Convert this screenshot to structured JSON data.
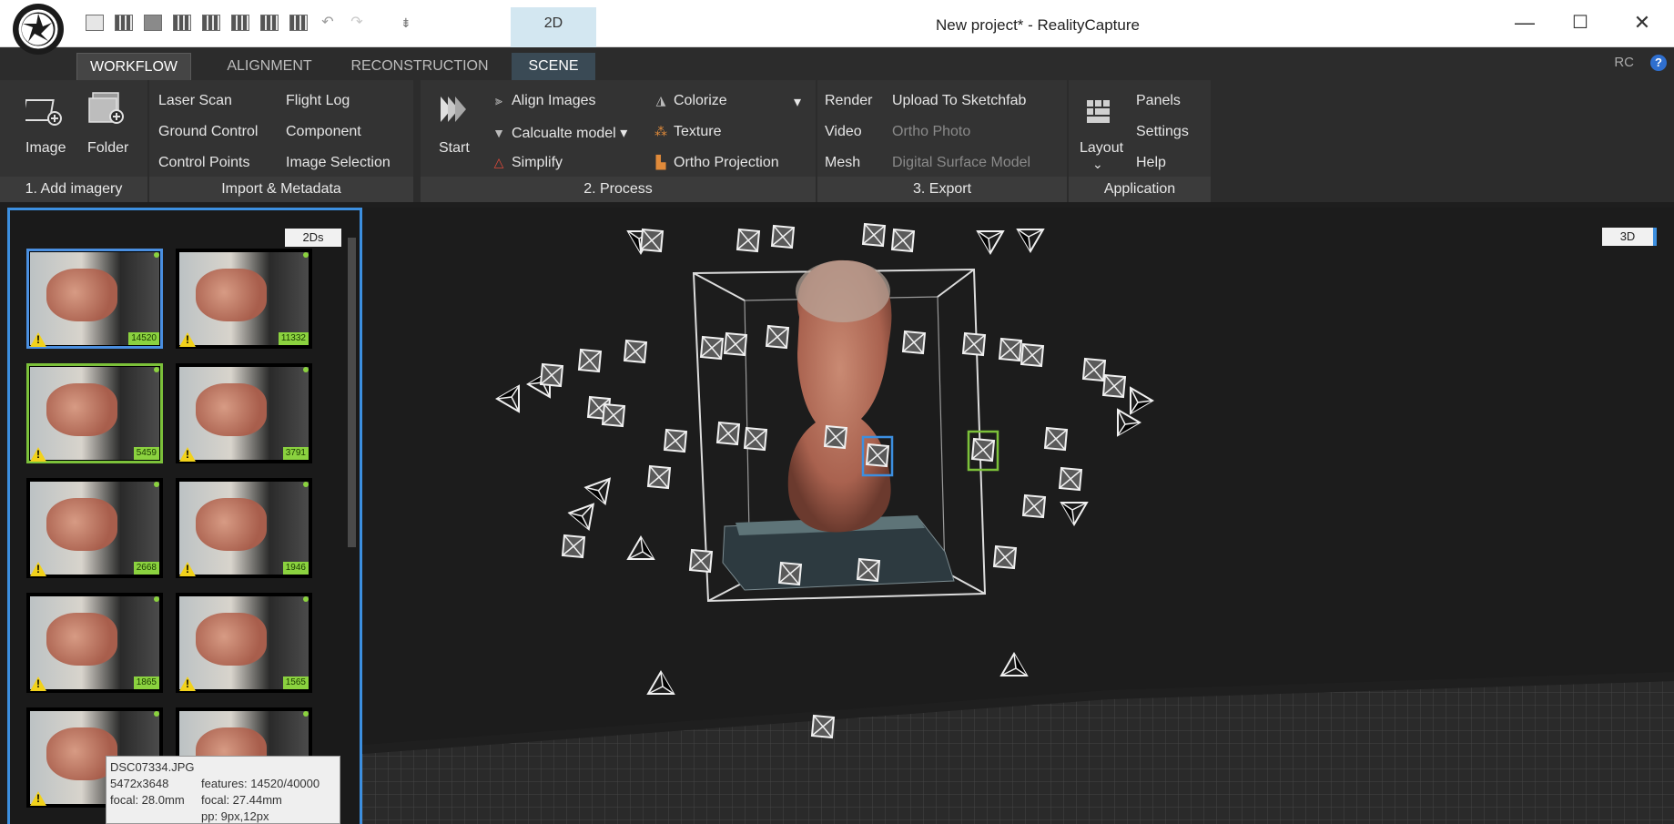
{
  "window": {
    "title": "New project* - RealityCapture",
    "minimize_glyph": "—",
    "maximize_glyph": "☐",
    "close_glyph": "✕"
  },
  "quick_access": {
    "icons": [
      "layout-1-icon",
      "layout-2-icon",
      "layout-3-icon",
      "layout-4-icon",
      "layout-5-icon",
      "layout-6-icon",
      "layout-7-icon",
      "layout-8-icon",
      "undo-icon",
      "redo-icon",
      "customize-icon"
    ],
    "undo_glyph": "↶",
    "redo_glyph": "↷",
    "customize_glyph": "⇟"
  },
  "view_tab_2d": "2D",
  "tabs": [
    {
      "label": "WORKFLOW",
      "active": true
    },
    {
      "label": "ALIGNMENT",
      "active": false
    },
    {
      "label": "RECONSTRUCTION",
      "active": false
    },
    {
      "label": "SCENE",
      "active": false
    }
  ],
  "rc_label": "RC",
  "help_glyph": "?",
  "ribbon": {
    "add_imagery": {
      "label": "1. Add imagery",
      "image": "Image",
      "folder": "Folder"
    },
    "import_metadata": {
      "label": "Import & Metadata",
      "col1": [
        "Laser Scan",
        "Ground Control",
        "Control Points"
      ],
      "col2": [
        "Flight Log",
        "Component",
        "Image Selection"
      ]
    },
    "process": {
      "label": "2. Process",
      "start": "Start",
      "align_images": "Align Images",
      "calculate_model": "Calcualte model",
      "simplify": "Simplify",
      "colorize": "Colorize",
      "texture": "Texture",
      "ortho_projection": "Ortho Projection",
      "dropdown_glyph": "▾"
    },
    "export": {
      "label": "3. Export",
      "col1": [
        "Render",
        "Video",
        "Mesh"
      ],
      "col2": [
        "Upload To Sketchfab",
        "Ortho Photo",
        "Digital Surface Model"
      ]
    },
    "application": {
      "label": "Application",
      "layout": "Layout",
      "layout_arrow": "⌄",
      "items": [
        "Panels",
        "Settings",
        "Help"
      ]
    }
  },
  "left_panel": {
    "tag": "2Ds",
    "thumbnails": [
      {
        "count": "14520",
        "state": "blue"
      },
      {
        "count": "11332",
        "state": "none"
      },
      {
        "count": "5459",
        "state": "green"
      },
      {
        "count": "3791",
        "state": "none"
      },
      {
        "count": "2668",
        "state": "none"
      },
      {
        "count": "1946",
        "state": "none"
      },
      {
        "count": "1865",
        "state": "none"
      },
      {
        "count": "1565",
        "state": "none"
      },
      {
        "count": "",
        "state": "none"
      },
      {
        "count": "",
        "state": "none"
      }
    ],
    "warning_glyph": "!",
    "tooltip": {
      "filename": "DSC07334.JPG",
      "resolution": "5472x3648",
      "focal": "focal: 28.0mm",
      "features": "features: 14520/40000",
      "focal_est": "focal: 27.44mm",
      "pp": "pp: 9px,12px"
    }
  },
  "viewport": {
    "tag": "3D"
  },
  "colors": {
    "accent_blue": "#3c8fe0",
    "selected_green": "#7cc13a",
    "warning_yellow": "#f2d21b"
  }
}
